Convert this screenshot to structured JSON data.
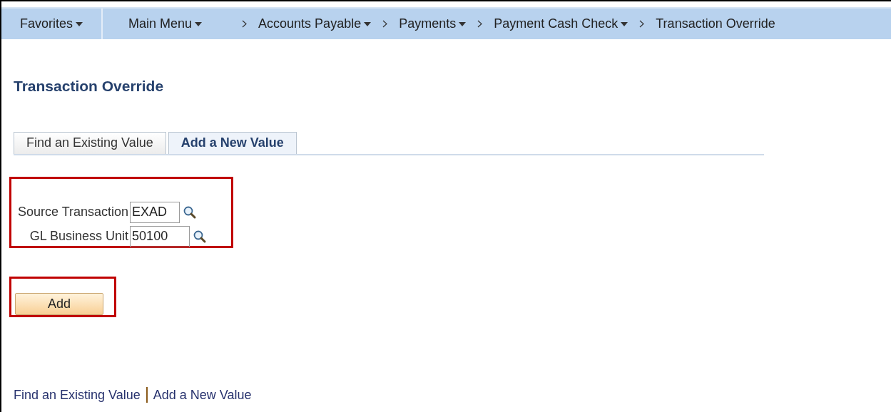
{
  "nav": {
    "items": [
      {
        "label": "Favorites",
        "dropdown": true,
        "separator_before": false
      },
      {
        "label": "Main Menu",
        "dropdown": true,
        "separator_before": false
      },
      {
        "label": "Accounts Payable",
        "dropdown": true,
        "separator_before": true
      },
      {
        "label": "Payments",
        "dropdown": true,
        "separator_before": true
      },
      {
        "label": "Payment Cash Check",
        "dropdown": true,
        "separator_before": true
      },
      {
        "label": "Transaction Override",
        "dropdown": false,
        "separator_before": true
      }
    ]
  },
  "page_title": "Transaction Override",
  "tabs": [
    {
      "label": "Find an Existing Value",
      "selected": false
    },
    {
      "label": "Add a New Value",
      "selected": true
    }
  ],
  "fields": [
    {
      "label": "Source Transaction",
      "value": "EXAD"
    },
    {
      "label": "GL Business Unit",
      "value": "50100"
    }
  ],
  "add_button": "Add",
  "footer_links": [
    "Find an Existing Value",
    "Add a New Value"
  ]
}
